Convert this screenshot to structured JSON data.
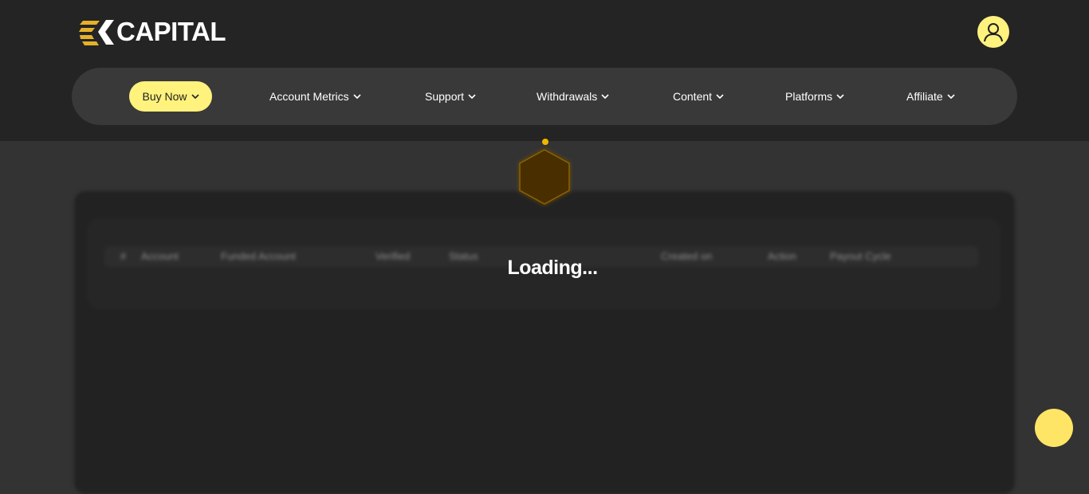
{
  "brand": {
    "name": "CAPITAL",
    "accent": "#fff27d",
    "logo_gold": "#e6b12a"
  },
  "header": {
    "user_icon": "user-icon"
  },
  "nav": {
    "buy_now": "Buy Now",
    "items": [
      {
        "label": "Account Metrics"
      },
      {
        "label": "Support"
      },
      {
        "label": "Withdrawals"
      },
      {
        "label": "Content"
      },
      {
        "label": "Platforms"
      },
      {
        "label": "Affiliate"
      }
    ],
    "chevron_icon": "chevron-down-icon"
  },
  "table": {
    "columns": [
      "#",
      "Account",
      "Funded Account",
      "Verified",
      "Status",
      "Created on",
      "Action",
      "Payout Cycle"
    ],
    "empty_text": ""
  },
  "loader": {
    "text": "Loading..."
  },
  "chat": {
    "icon": "chat-bubble-icon",
    "color": "#ffe566"
  }
}
